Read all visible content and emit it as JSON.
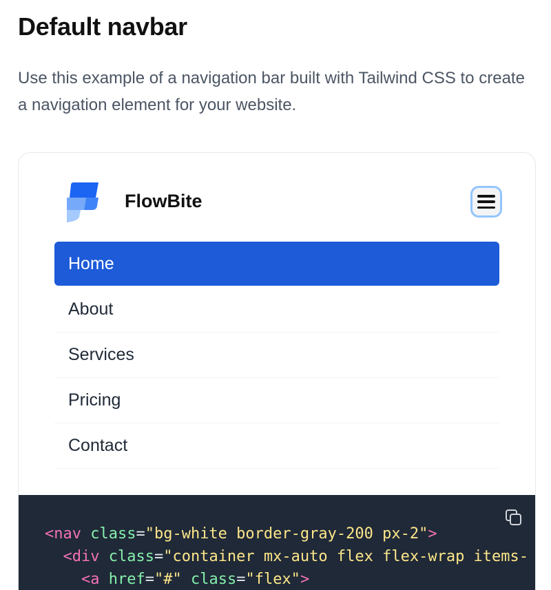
{
  "heading": "Default navbar",
  "description": "Use this example of a navigation bar built with Tailwind CSS to create a navigation element for your website.",
  "navbar": {
    "brand_name": "FlowBite",
    "logo_icon": "flowbite-logo-icon",
    "menu_icon": "hamburger-menu-icon",
    "items": [
      {
        "label": "Home",
        "active": true
      },
      {
        "label": "About",
        "active": false
      },
      {
        "label": "Services",
        "active": false
      },
      {
        "label": "Pricing",
        "active": false
      },
      {
        "label": "Contact",
        "active": false
      }
    ]
  },
  "code": {
    "copy_icon": "copy-icon",
    "lines": [
      [
        [
          "tag",
          "<nav"
        ],
        [
          "punc",
          " "
        ],
        [
          "attr",
          "class"
        ],
        [
          "punc",
          "="
        ],
        [
          "str",
          "\"bg-white border-gray-200 px-2\""
        ],
        [
          "tag",
          ">"
        ]
      ],
      [
        [
          "punc",
          "  "
        ],
        [
          "tag",
          "<div"
        ],
        [
          "punc",
          " "
        ],
        [
          "attr",
          "class"
        ],
        [
          "punc",
          "="
        ],
        [
          "str",
          "\"container mx-auto flex flex-wrap items-"
        ]
      ],
      [
        [
          "punc",
          "    "
        ],
        [
          "tag",
          "<a"
        ],
        [
          "punc",
          " "
        ],
        [
          "attr",
          "href"
        ],
        [
          "punc",
          "="
        ],
        [
          "str",
          "\"#\""
        ],
        [
          "punc",
          " "
        ],
        [
          "attr",
          "class"
        ],
        [
          "punc",
          "="
        ],
        [
          "str",
          "\"flex\""
        ],
        [
          "tag",
          ">"
        ]
      ]
    ]
  },
  "colors": {
    "accent": "#1d5bd8",
    "code_bg": "#1f2937",
    "menu_ring": "#93c5fd"
  }
}
